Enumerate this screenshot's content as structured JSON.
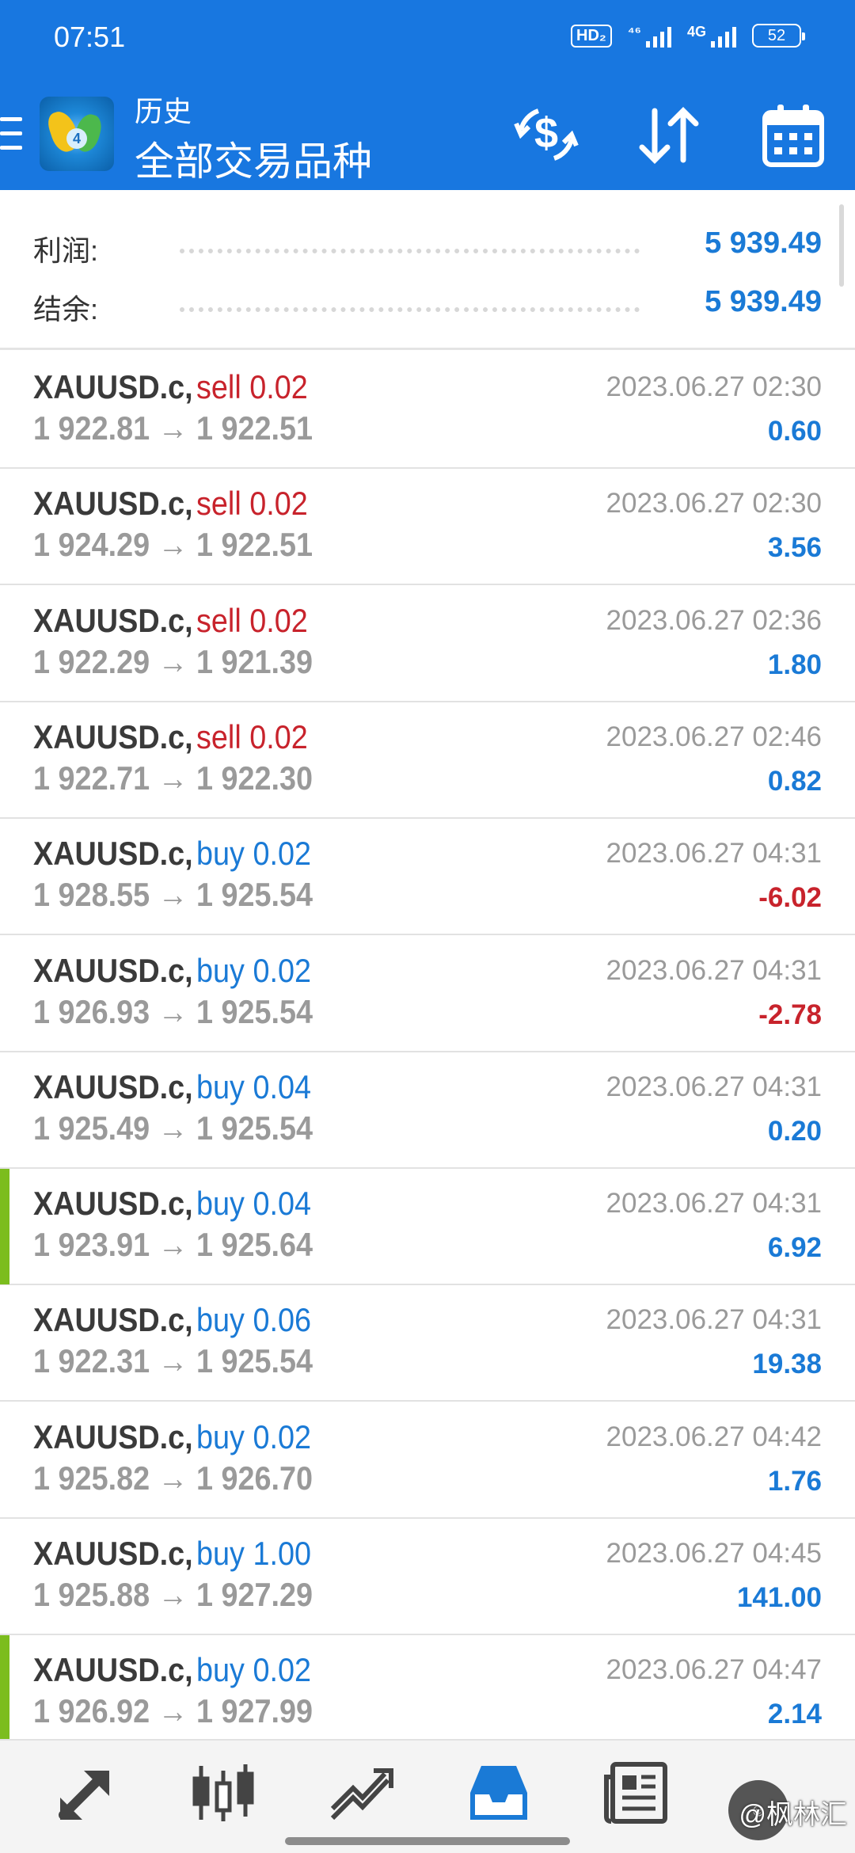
{
  "status_bar": {
    "time": "07:51",
    "hd": "HD₂",
    "net1": "⁴⁶",
    "net2": "4G",
    "battery": "52"
  },
  "header": {
    "title": "历史",
    "subtitle": "全部交易品种"
  },
  "summary": {
    "profit_label": "利润:",
    "profit_value": "5 939.49",
    "balance_label": "结余:",
    "balance_value": "5 939.49"
  },
  "deals": [
    {
      "symbol": "XAUUSD.c,",
      "side": "sell",
      "volume": "0.02",
      "prices": "1 922.81 → 1 922.51",
      "time": "2023.06.27 02:30",
      "profit": "0.60",
      "marked": false
    },
    {
      "symbol": "XAUUSD.c,",
      "side": "sell",
      "volume": "0.02",
      "prices": "1 924.29 → 1 922.51",
      "time": "2023.06.27 02:30",
      "profit": "3.56",
      "marked": false
    },
    {
      "symbol": "XAUUSD.c,",
      "side": "sell",
      "volume": "0.02",
      "prices": "1 922.29 → 1 921.39",
      "time": "2023.06.27 02:36",
      "profit": "1.80",
      "marked": false
    },
    {
      "symbol": "XAUUSD.c,",
      "side": "sell",
      "volume": "0.02",
      "prices": "1 922.71 → 1 922.30",
      "time": "2023.06.27 02:46",
      "profit": "0.82",
      "marked": false
    },
    {
      "symbol": "XAUUSD.c,",
      "side": "buy",
      "volume": "0.02",
      "prices": "1 928.55 → 1 925.54",
      "time": "2023.06.27 04:31",
      "profit": "-6.02",
      "marked": false
    },
    {
      "symbol": "XAUUSD.c,",
      "side": "buy",
      "volume": "0.02",
      "prices": "1 926.93 → 1 925.54",
      "time": "2023.06.27 04:31",
      "profit": "-2.78",
      "marked": false
    },
    {
      "symbol": "XAUUSD.c,",
      "side": "buy",
      "volume": "0.04",
      "prices": "1 925.49 → 1 925.54",
      "time": "2023.06.27 04:31",
      "profit": "0.20",
      "marked": false
    },
    {
      "symbol": "XAUUSD.c,",
      "side": "buy",
      "volume": "0.04",
      "prices": "1 923.91 → 1 925.64",
      "time": "2023.06.27 04:31",
      "profit": "6.92",
      "marked": true
    },
    {
      "symbol": "XAUUSD.c,",
      "side": "buy",
      "volume": "0.06",
      "prices": "1 922.31 → 1 925.54",
      "time": "2023.06.27 04:31",
      "profit": "19.38",
      "marked": false
    },
    {
      "symbol": "XAUUSD.c,",
      "side": "buy",
      "volume": "0.02",
      "prices": "1 925.82 → 1 926.70",
      "time": "2023.06.27 04:42",
      "profit": "1.76",
      "marked": false
    },
    {
      "symbol": "XAUUSD.c,",
      "side": "buy",
      "volume": "1.00",
      "prices": "1 925.88 → 1 927.29",
      "time": "2023.06.27 04:45",
      "profit": "141.00",
      "marked": false
    },
    {
      "symbol": "XAUUSD.c,",
      "side": "buy",
      "volume": "0.02",
      "prices": "1 926.92 → 1 927.99",
      "time": "2023.06.27 04:47",
      "profit": "2.14",
      "marked": true
    }
  ],
  "nav": [
    {
      "icon": "quotes-icon"
    },
    {
      "icon": "chart-icon"
    },
    {
      "icon": "trade-icon"
    },
    {
      "icon": "history-icon",
      "active": true
    },
    {
      "icon": "news-icon"
    }
  ],
  "watermark": "@枫林汇",
  "colors": {
    "primary": "#1877e0",
    "profit": "#1a7ad6",
    "loss": "#c8232c",
    "marker": "#7cbd1e"
  }
}
